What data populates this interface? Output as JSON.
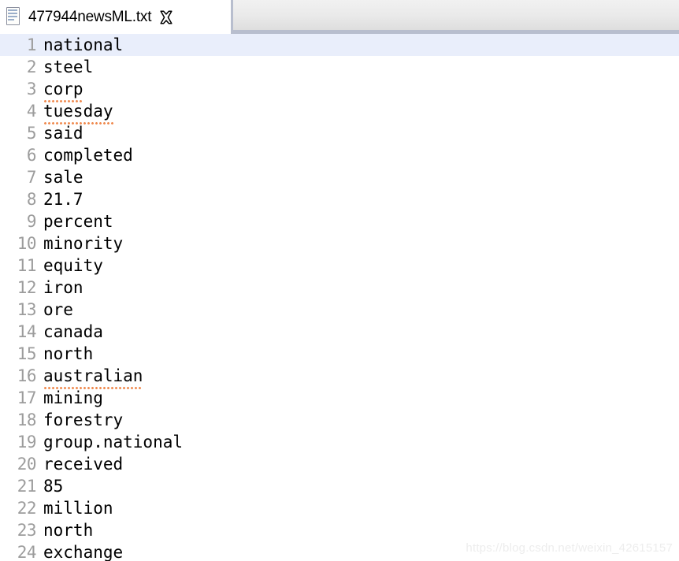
{
  "window": {
    "background_color": "#ffffff"
  },
  "tabbar": {
    "background_color": "#e6e6e6",
    "border_color": "#b8bece",
    "active_tab": {
      "title": "477944newsML.txt",
      "file_icon": "text-file-icon",
      "close_icon": "close-icon",
      "selected": true
    }
  },
  "editor": {
    "line_number_color": "#9c9c9c",
    "text_color": "#000000",
    "current_line_highlight_color": "#e9eefb",
    "spellcheck_underline_color": "#ef8b50",
    "current_line": 1,
    "lines": [
      {
        "n": "1",
        "text": "national",
        "misspelled": false,
        "current": true
      },
      {
        "n": "2",
        "text": "steel",
        "misspelled": false,
        "current": false
      },
      {
        "n": "3",
        "text": "corp",
        "misspelled": true,
        "current": false
      },
      {
        "n": "4",
        "text": "tuesday",
        "misspelled": true,
        "current": false
      },
      {
        "n": "5",
        "text": "said",
        "misspelled": false,
        "current": false
      },
      {
        "n": "6",
        "text": "completed",
        "misspelled": false,
        "current": false
      },
      {
        "n": "7",
        "text": "sale",
        "misspelled": false,
        "current": false
      },
      {
        "n": "8",
        "text": "21.7",
        "misspelled": false,
        "current": false
      },
      {
        "n": "9",
        "text": "percent",
        "misspelled": false,
        "current": false
      },
      {
        "n": "10",
        "text": "minority",
        "misspelled": false,
        "current": false
      },
      {
        "n": "11",
        "text": "equity",
        "misspelled": false,
        "current": false
      },
      {
        "n": "12",
        "text": "iron",
        "misspelled": false,
        "current": false
      },
      {
        "n": "13",
        "text": "ore",
        "misspelled": false,
        "current": false
      },
      {
        "n": "14",
        "text": "canada",
        "misspelled": false,
        "current": false
      },
      {
        "n": "15",
        "text": "north",
        "misspelled": false,
        "current": false
      },
      {
        "n": "16",
        "text": "australian",
        "misspelled": true,
        "current": false
      },
      {
        "n": "17",
        "text": "mining",
        "misspelled": false,
        "current": false
      },
      {
        "n": "18",
        "text": "forestry",
        "misspelled": false,
        "current": false
      },
      {
        "n": "19",
        "text": "group.national",
        "misspelled": false,
        "current": false
      },
      {
        "n": "20",
        "text": "received",
        "misspelled": false,
        "current": false
      },
      {
        "n": "21",
        "text": "85",
        "misspelled": false,
        "current": false
      },
      {
        "n": "22",
        "text": "million",
        "misspelled": false,
        "current": false
      },
      {
        "n": "23",
        "text": "north",
        "misspelled": false,
        "current": false
      },
      {
        "n": "24",
        "text": "exchange",
        "misspelled": false,
        "current": false
      }
    ]
  },
  "watermark": {
    "text": "https://blog.csdn.net/weixin_42615157"
  }
}
